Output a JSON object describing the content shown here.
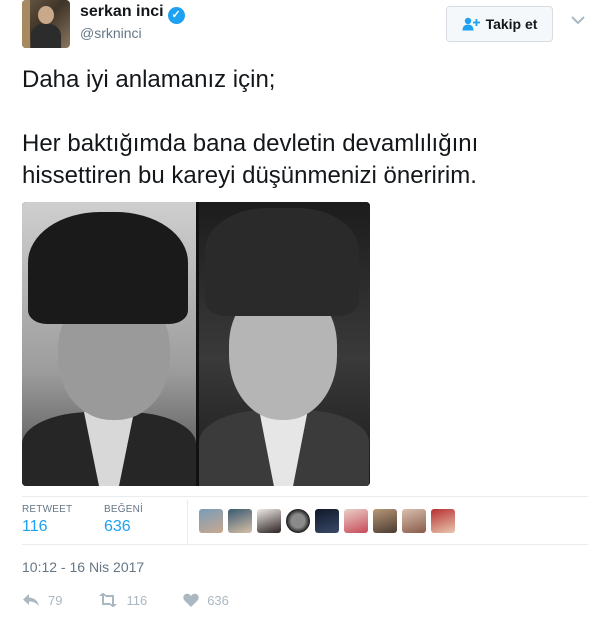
{
  "author": {
    "name": "serkan inci",
    "handle": "@srkninci",
    "verified_badge": "✓"
  },
  "follow_button": {
    "label": "Takip et"
  },
  "tweet": {
    "text": "Daha iyi anlamanız için;\n\nHer baktığımda bana devletin devamlılığını\nhissettiren bu kareyi düşünmenizi öneririm."
  },
  "stats": {
    "retweets": {
      "label": "RETWEET",
      "count": "116"
    },
    "likes": {
      "label": "BEĞENİ",
      "count": "636"
    },
    "liker_avatars": 9
  },
  "timestamp": "10:12 - 16 Nis 2017",
  "actions": {
    "reply": {
      "icon": "reply-icon",
      "count": "79"
    },
    "retweet": {
      "icon": "retweet-icon",
      "count": "116"
    },
    "like": {
      "icon": "heart-icon",
      "count": "636"
    }
  },
  "colors": {
    "accent": "#1da1f2",
    "text": "#14171a",
    "muted": "#657786",
    "action": "#aab8c2"
  }
}
